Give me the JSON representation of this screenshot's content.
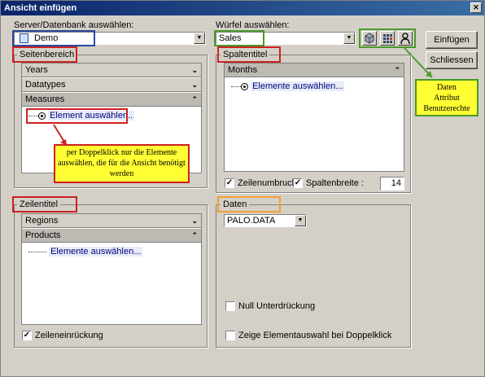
{
  "window": {
    "title": "Ansicht einfügen",
    "close_glyph": "✕"
  },
  "server": {
    "label": "Server/Datenbank auswählen:",
    "value": "Demo"
  },
  "cube": {
    "label": "Würfel auswählen:",
    "value": "Sales"
  },
  "buttons": {
    "insert": "Einfügen",
    "close": "Schliessen"
  },
  "cube_icons": [
    "cube-icon",
    "grid-attribute-icon",
    "user-icon"
  ],
  "callout_cube_icons": {
    "line1": "Daten",
    "line2": "Attribut",
    "line3": "Benutzerechte"
  },
  "page_area": {
    "legend": "Seitenbereich",
    "dimensions": [
      {
        "name": "Years",
        "state": "collapsed"
      },
      {
        "name": "Datatypes",
        "state": "collapsed"
      },
      {
        "name": "Measures",
        "state": "expanded"
      }
    ],
    "element": "Element auswählen.."
  },
  "callout_doubleclick": "per Doppelklick nur die Elemente auswählen, die für die Ansicht benötigt werden",
  "column_title": {
    "legend": "Spaltentitel",
    "dimensions": [
      {
        "name": "Months",
        "state": "expanded"
      }
    ],
    "element": "Elemente auswählen...",
    "wrap_label": "Zeilenumbruch",
    "wrap_checked": true,
    "width_label": "Spaltenbreite :",
    "width_checked": true,
    "width_value": "14"
  },
  "row_title": {
    "legend": "Zeilentitel",
    "dimensions": [
      {
        "name": "Regions",
        "state": "collapsed"
      },
      {
        "name": "Products",
        "state": "expanded"
      }
    ],
    "element": "Elemente auswählen...",
    "indent_label": "Zeileneinrückung",
    "indent_checked": true
  },
  "data": {
    "legend": "Daten",
    "value": "PALO.DATA",
    "null_suppress_label": "Null Unterdrückung",
    "null_suppress_checked": false,
    "show_elem_label": "Zeige Elementauswahl bei Doppelklick",
    "show_elem_checked": false
  },
  "colors": {
    "red": "#cc2222",
    "green": "#4a9a2a",
    "blue": "#2a4a9a",
    "orange": "#f0a030",
    "callout_yellow": "#ffff33"
  }
}
